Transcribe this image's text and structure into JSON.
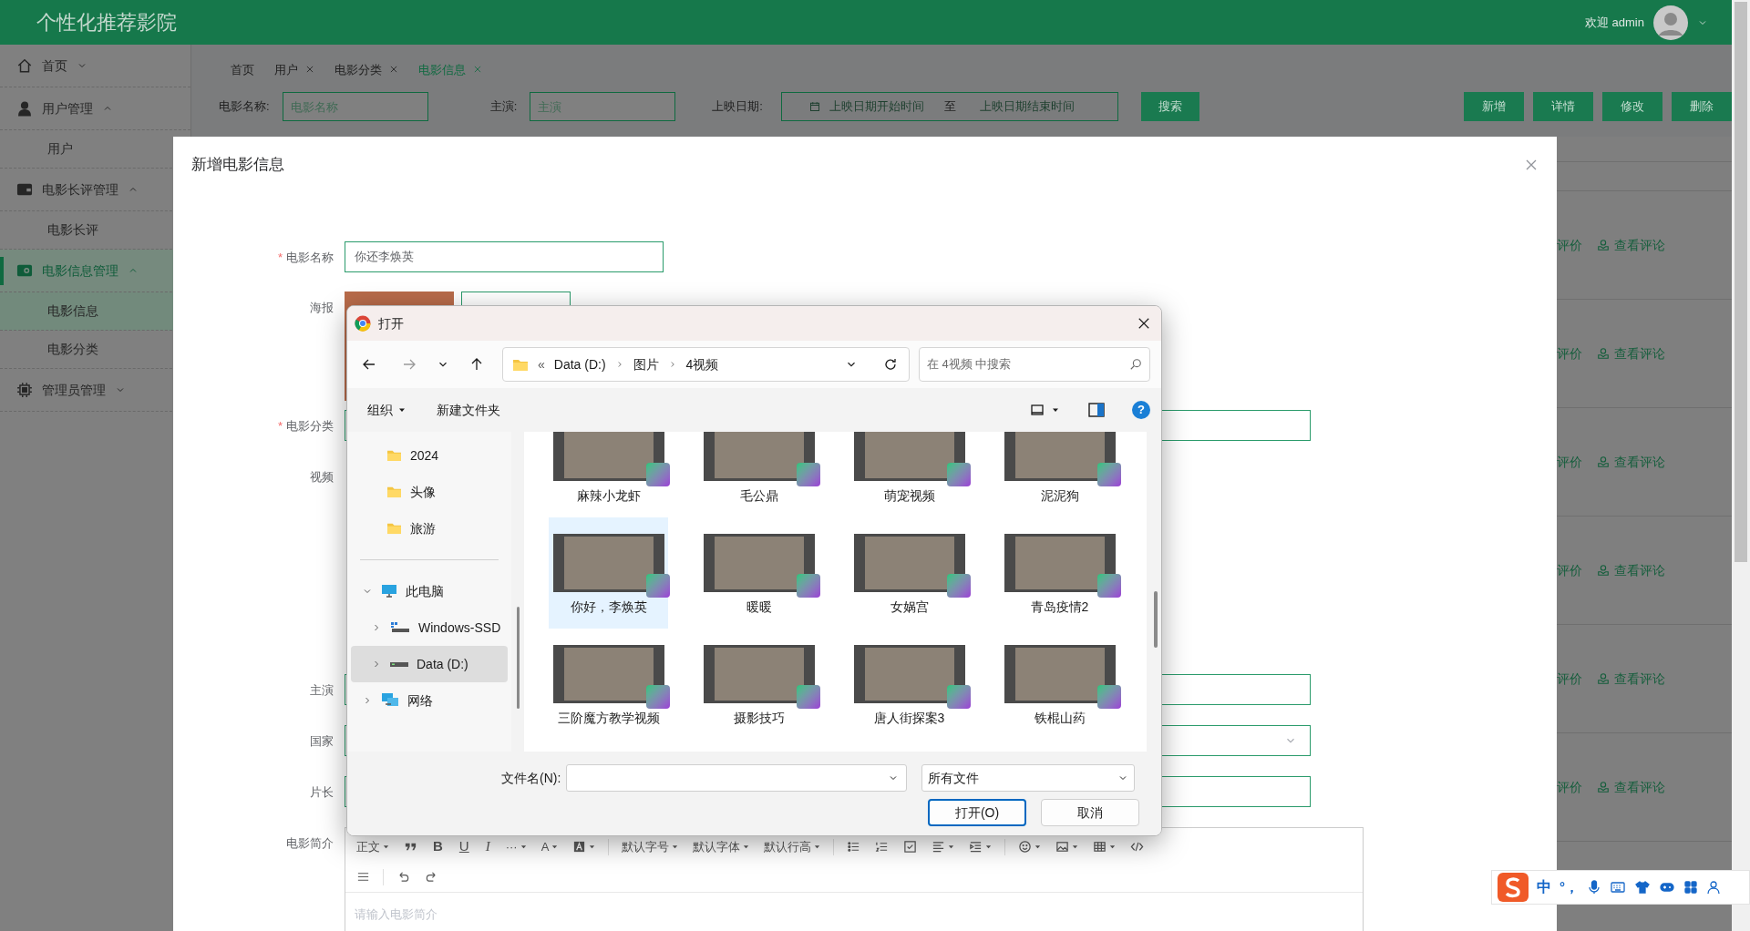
{
  "header": {
    "title": "个性化推荐影院",
    "welcome": "欢迎 admin"
  },
  "sidebar": [
    {
      "label": "首页",
      "expanded": false,
      "selected": false
    },
    {
      "label": "用户管理",
      "expanded": true,
      "selected": false,
      "children": [
        {
          "label": "用户",
          "selected": false
        }
      ]
    },
    {
      "label": "电影长评管理",
      "expanded": true,
      "selected": false,
      "children": [
        {
          "label": "电影长评",
          "selected": false
        }
      ]
    },
    {
      "label": "电影信息管理",
      "expanded": true,
      "selected": true,
      "children": [
        {
          "label": "电影信息",
          "selected": true
        },
        {
          "label": "电影分类",
          "selected": false
        }
      ]
    },
    {
      "label": "管理员管理",
      "expanded": false,
      "selected": false
    }
  ],
  "tabs": [
    {
      "label": "首页",
      "closable": false,
      "selected": false
    },
    {
      "label": "用户",
      "closable": true,
      "selected": false
    },
    {
      "label": "电影分类",
      "closable": true,
      "selected": false
    },
    {
      "label": "电影信息",
      "closable": true,
      "selected": true
    }
  ],
  "filters": {
    "fields": [
      {
        "label": "电影名称:",
        "placeholder": "电影名称"
      },
      {
        "label": "主演:",
        "placeholder": "主演"
      }
    ],
    "date_range": {
      "label": "上映日期:",
      "start_placeholder": "上映日期开始时间",
      "separator": "至",
      "end_placeholder": "上映日期结束时间"
    },
    "search_button": "搜索"
  },
  "actions": [
    "新增",
    "详情",
    "修改",
    "删除"
  ],
  "table_rows": [
    {
      "column_1": "评价",
      "column_2": "查看评论"
    },
    {
      "column_1": "评价",
      "column_2": "查看评论"
    },
    {
      "column_1": "评价",
      "column_2": "查看评论"
    },
    {
      "column_1": "评价",
      "column_2": "查看评论"
    },
    {
      "column_1": "评价",
      "column_2": "查看评论"
    },
    {
      "column_1": "评价",
      "column_2": "查看评论"
    }
  ],
  "modal": {
    "title": "新增电影信息",
    "fields": [
      {
        "kind": "short-text",
        "label": "电影名称",
        "required_mark": "*",
        "value": "你还李焕英"
      },
      {
        "kind": "image",
        "label": "海报"
      },
      {
        "kind": "text",
        "label": "电影分类",
        "required_mark": "*"
      },
      {
        "kind": "video",
        "label": "视频"
      },
      {
        "kind": "text",
        "label": "主演"
      },
      {
        "kind": "select",
        "label": "国家"
      },
      {
        "kind": "text",
        "label": "片长"
      },
      {
        "kind": "editor",
        "label": "电影简介",
        "placeholder": "请输入电影简介"
      }
    ],
    "editor_toolbar": [
      [
        {
          "kind": "menu",
          "label": "正文"
        },
        {
          "kind": "icon"
        },
        {
          "kind": "bold",
          "label": "B"
        },
        {
          "kind": "underline",
          "label": "U"
        },
        {
          "kind": "italic",
          "label": "I"
        },
        {
          "kind": "menu",
          "label": "···"
        },
        {
          "kind": "menu",
          "label": "A"
        },
        {
          "kind": "menu-icon"
        },
        {
          "kind": "divider"
        },
        {
          "kind": "menu",
          "label": "默认字号"
        },
        {
          "kind": "menu",
          "label": "默认字体"
        },
        {
          "kind": "menu",
          "label": "默认行高"
        },
        {
          "kind": "divider"
        },
        {
          "kind": "icon"
        },
        {
          "kind": "icon"
        },
        {
          "kind": "icon"
        },
        {
          "kind": "menu-icon"
        },
        {
          "kind": "menu-icon"
        },
        {
          "kind": "divider"
        },
        {
          "kind": "menu-icon"
        },
        {
          "kind": "menu-icon"
        },
        {
          "kind": "menu-icon"
        },
        {
          "kind": "icon"
        }
      ],
      [
        {
          "kind": "icon"
        },
        {
          "kind": "divider"
        },
        {
          "kind": "icon"
        },
        {
          "kind": "icon"
        }
      ]
    ]
  },
  "file_dialog": {
    "title": "打开",
    "path_prefix": "«",
    "path": [
      "Data (D:)",
      "图片",
      "4视频"
    ],
    "search_placeholder": "在 4视频 中搜索",
    "organize": "组织",
    "new_folder": "新建文件夹",
    "help": "?",
    "folders": [
      "2024",
      "头像",
      "旅游"
    ],
    "tree": [
      {
        "label": "此电脑",
        "expanded": true,
        "selected": false,
        "children": [
          {
            "label": "Windows-SSD",
            "expanded": false,
            "selected": false
          },
          {
            "label": "Data (D:)",
            "expanded": false,
            "selected": true
          }
        ]
      },
      {
        "label": "网络",
        "expanded": false,
        "selected": false
      }
    ],
    "files": [
      {
        "name": "麻辣小龙虾",
        "selected": false
      },
      {
        "name": "毛公鼎",
        "selected": false
      },
      {
        "name": "萌宠视频",
        "selected": false
      },
      {
        "name": "泥泥狗",
        "selected": false
      },
      {
        "name": "你好，李焕英",
        "selected": true
      },
      {
        "name": "暖暖",
        "selected": false
      },
      {
        "name": "女娲宫",
        "selected": false
      },
      {
        "name": "青岛疫情2",
        "selected": false
      },
      {
        "name": "三阶魔方教学视频",
        "selected": false
      },
      {
        "name": "摄影技巧",
        "selected": false
      },
      {
        "name": "唐人街探案3",
        "selected": false
      },
      {
        "name": "铁棍山药",
        "selected": false
      }
    ],
    "file_name_label": "文件名(N):",
    "file_type": "所有文件",
    "open_button": "打开(O)",
    "cancel_button": "取消"
  },
  "ime_bar": {
    "mode": "中",
    "punctuation": "°，"
  }
}
